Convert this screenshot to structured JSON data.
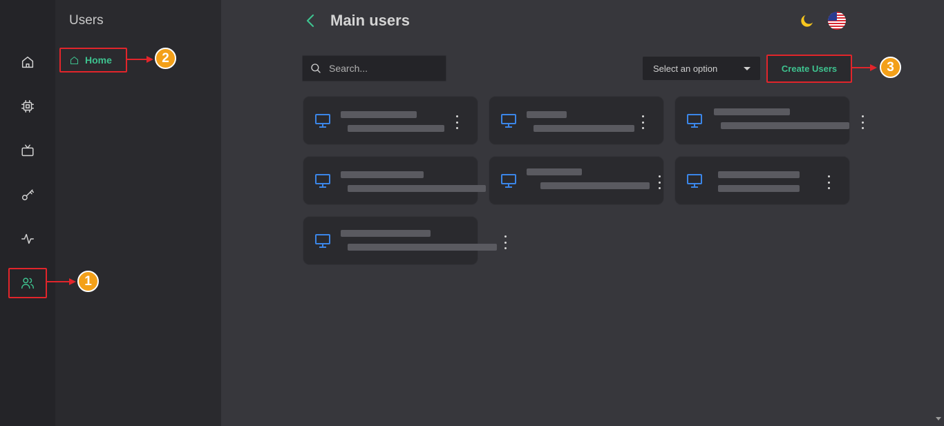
{
  "subnav": {
    "title": "Users",
    "home_label": "Home"
  },
  "header": {
    "title": "Main users"
  },
  "toolbar": {
    "search_placeholder": "Search...",
    "select_label": "Select an option",
    "create_label": "Create Users"
  },
  "rail": {
    "items": [
      {
        "icon": "home-icon",
        "active": false
      },
      {
        "icon": "chip-icon",
        "active": false
      },
      {
        "icon": "tv-icon",
        "active": false
      },
      {
        "icon": "key-icon",
        "active": false
      },
      {
        "icon": "activity-icon",
        "active": false
      },
      {
        "icon": "users-icon",
        "active": true
      }
    ]
  },
  "cards": [
    {
      "icon": "monitor-icon"
    },
    {
      "icon": "monitor-icon"
    },
    {
      "icon": "monitor-icon"
    },
    {
      "icon": "monitor-icon"
    },
    {
      "icon": "monitor-icon"
    },
    {
      "icon": "monitor-icon"
    },
    {
      "icon": "monitor-icon"
    }
  ],
  "callouts": {
    "step1": "1",
    "step2": "2",
    "step3": "3"
  },
  "colors": {
    "accent": "#3ec28f",
    "monitor": "#3b86e8",
    "callout_red": "#e2252b",
    "badge_orange": "#f3a019"
  }
}
